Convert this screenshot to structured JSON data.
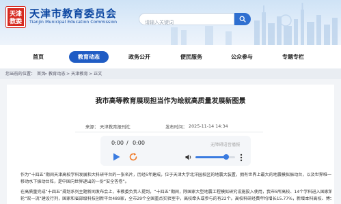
{
  "header": {
    "logo_text": "天津教委",
    "title": "天津市教育委员会",
    "subtitle": "Tianjin Municipal Education Commission",
    "search_placeholder": "请输入关键词",
    "search_icon": "search-icon"
  },
  "nav": {
    "items": [
      {
        "label": "首页",
        "active": false
      },
      {
        "label": "教育动态",
        "active": true
      },
      {
        "label": "政务公开",
        "active": false
      },
      {
        "label": "便民服务",
        "active": false
      },
      {
        "label": "公众参与",
        "active": false
      },
      {
        "label": "专题专栏",
        "active": false
      }
    ]
  },
  "breadcrumb": {
    "prefix": "您当前的位置：",
    "items": [
      "首页",
      "教育动态",
      "天津教育",
      "正文"
    ],
    "separator": ">"
  },
  "article": {
    "title": "我市高等教育展现担当作为绘就高质量发展新图景",
    "source_label": "来源：",
    "source": "天津教育报刊社",
    "date_label": "发布时间：",
    "date": "2025-11-14 14:34",
    "paragraphs": [
      "作为“十四五”期间天津高校学科发展和大科研平台的一张名片，历经5年建成，位于天津大学北洋园校区的地震大装置，拥有世界上最大的地震模拟振动台，以及世界唯一的可",
      "移动水下振动台阵，是中国向世界递出的一份“安全答卷”。",
      "在高质量完成“十四五”规划系列主题新闻发布会上，市教委负责人提到，“十四五”期间，除国家大型地震工程模拟研究设施投入使用，我市5所高校、14个学科进入国家第二",
      "轮“双一流”建设行列，国家和省部级科技创新平台489家，全市29个全国重点实验室中，高校牵头或参与的有22个。高校科研经费年均增长15.77%，新增本科高校、博士授权单位"
    ]
  },
  "player": {
    "current_time": "0:00",
    "total_time": "0:00",
    "tts_label": "无障碍语音播报",
    "volume": 0.78,
    "play_icon": "play-icon",
    "replay_icon": "replay-icon",
    "volume_icon": "volume-icon",
    "more_icon": "more-options-icon"
  },
  "colors": {
    "brand_blue": "#1f5cc4",
    "title_blue": "#0d47a1",
    "logo_red": "#d62a20",
    "accent_orange": "#f07b2a"
  }
}
